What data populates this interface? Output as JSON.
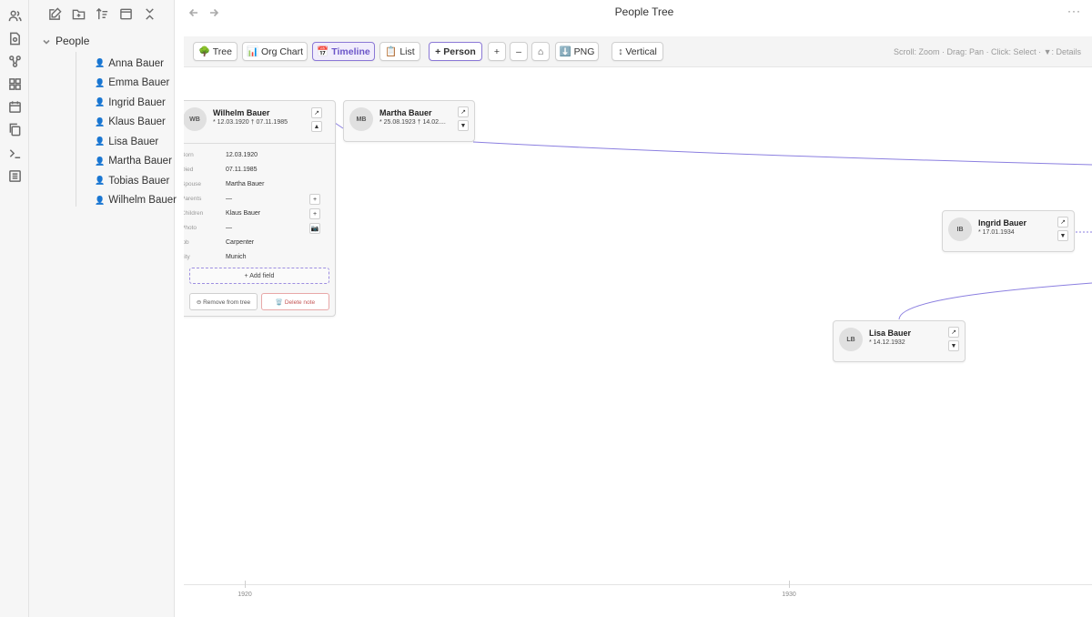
{
  "header": {
    "title": "People Tree",
    "more": "···"
  },
  "sidebar": {
    "folder": "People",
    "files": [
      "Anna Bauer",
      "Emma Bauer",
      "Ingrid Bauer",
      "Klaus Bauer",
      "Lisa Bauer",
      "Martha Bauer",
      "Tobias Bauer",
      "Wilhelm Bauer"
    ]
  },
  "toolbar": {
    "tree": "🌳 Tree",
    "org": "📊 Org Chart",
    "timeline": "📅 Timeline",
    "list": "📋 List",
    "person": "+ Person",
    "zoom_in": "+",
    "zoom_out": "–",
    "home": "⌂",
    "png": "⬇️ PNG",
    "vertical": "↕ Vertical",
    "hint": "Scroll: Zoom · Drag: Pan · Click: Select · ▼: Details"
  },
  "cards": {
    "wilhelm": {
      "initials": "WB",
      "name": "Wilhelm Bauer",
      "dates": "* 12.03.1920 † 07.11.1985",
      "open": "↗",
      "toggle": "▲",
      "fields": [
        {
          "key": "Born",
          "value": "12.03.1920"
        },
        {
          "key": "Died",
          "value": "07.11.1985"
        },
        {
          "key": "Spouse",
          "value": "Martha Bauer"
        },
        {
          "key": "Parents",
          "value": "—"
        },
        {
          "key": "Children",
          "value": "Klaus Bauer"
        },
        {
          "key": "Photo",
          "value": "—"
        },
        {
          "key": "job",
          "value": "Carpenter"
        },
        {
          "key": "city",
          "value": "Munich"
        }
      ],
      "add_parent": "+",
      "add_child": "+",
      "photo_icon": "📷",
      "add_field": "+ Add field",
      "remove": "⊖ Remove from tree",
      "delete": "🗑️ Delete note"
    },
    "martha": {
      "initials": "MB",
      "name": "Martha Bauer",
      "dates": "* 25.08.1923 † 14.02....",
      "open": "↗",
      "toggle": "▼"
    },
    "ingrid": {
      "initials": "IB",
      "name": "Ingrid Bauer",
      "dates": "* 17.01.1934",
      "open": "↗",
      "toggle": "▼"
    },
    "lisa": {
      "initials": "LB",
      "name": "Lisa Bauer",
      "dates": "* 14.12.1932",
      "open": "↗",
      "toggle": "▼"
    }
  },
  "timeline": {
    "ticks": [
      "1920",
      "1930"
    ]
  },
  "colors": {
    "accent": "#8b78d6",
    "link": "#8b7fe0"
  }
}
